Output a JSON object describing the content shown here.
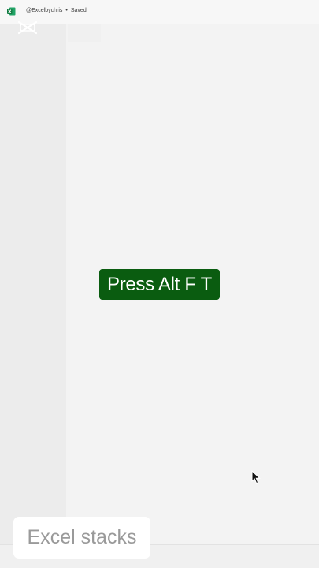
{
  "titlebar": {
    "app_icon": "excel-icon",
    "account": "@Excelbychris",
    "separator": "•",
    "status": "Saved"
  },
  "overlay": {
    "watermark_icon": "capcut-logo-icon",
    "key_instruction": "Press Alt F T",
    "caption": "Excel stacks"
  },
  "colors": {
    "excel_green": "#1d6f42",
    "badge_green": "#0a5c10",
    "caption_text": "#9a9a9a"
  },
  "cursor_icon": "mouse-pointer-icon"
}
